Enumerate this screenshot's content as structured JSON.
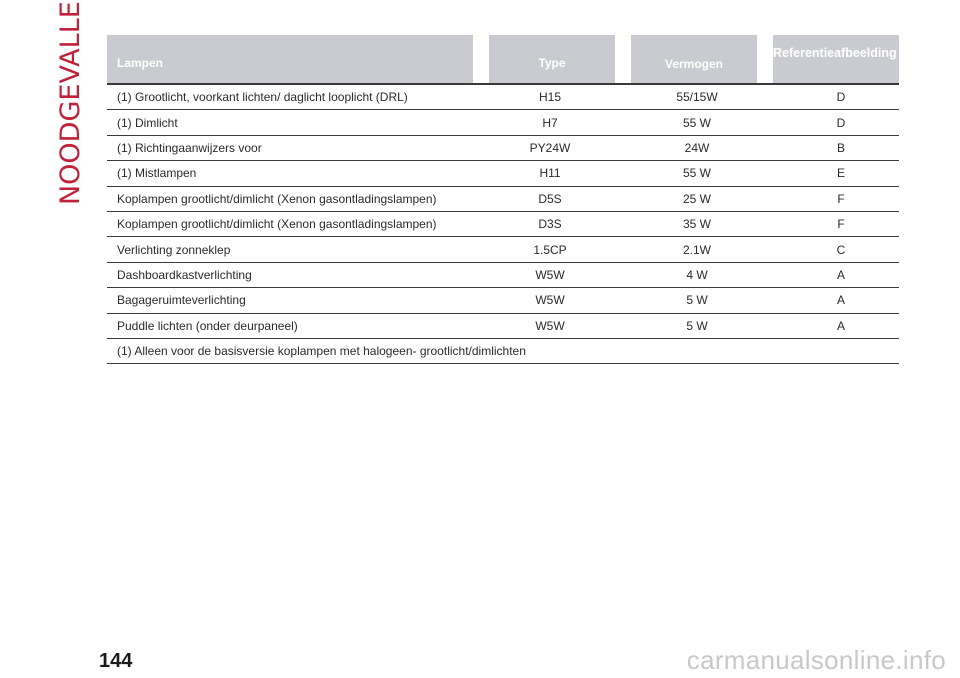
{
  "section_title": "NOODGEVALLEN",
  "table": {
    "headers": {
      "lampen": "Lampen",
      "type": "Type",
      "vermogen": "Vermogen",
      "referentie": "Referentieafbeelding"
    },
    "rows": [
      {
        "name": "(1) Grootlicht, voorkant lichten/ daglicht looplicht (DRL)",
        "type": "H15",
        "vermogen": "55/15W",
        "ref": "D"
      },
      {
        "name": "(1) Dimlicht",
        "type": "H7",
        "vermogen": "55 W",
        "ref": "D"
      },
      {
        "name": "(1) Richtingaanwijzers voor",
        "type": "PY24W",
        "vermogen": "24W",
        "ref": "B"
      },
      {
        "name": "(1) Mistlampen",
        "type": "H11",
        "vermogen": "55 W",
        "ref": "E"
      },
      {
        "name": "Koplampen grootlicht/dimlicht (Xenon gasontladingslampen)",
        "type": "D5S",
        "vermogen": "25 W",
        "ref": "F"
      },
      {
        "name": "Koplampen grootlicht/dimlicht (Xenon gasontladingslampen)",
        "type": "D3S",
        "vermogen": "35 W",
        "ref": "F"
      },
      {
        "name": "Verlichting zonneklep",
        "type": "1.5CP",
        "vermogen": "2.1W",
        "ref": "C"
      },
      {
        "name": "Dashboardkastverlichting",
        "type": "W5W",
        "vermogen": "4 W",
        "ref": "A"
      },
      {
        "name": "Bagageruimteverlichting",
        "type": "W5W",
        "vermogen": "5 W",
        "ref": "A"
      },
      {
        "name": "Puddle lichten (onder deurpaneel)",
        "type": "W5W",
        "vermogen": "5 W",
        "ref": "A"
      }
    ],
    "footnote": "(1) Alleen voor de basisversie koplampen met halogeen- grootlicht/dimlichten"
  },
  "page_number": "144",
  "watermark": "carmanualsonline.info",
  "colors": {
    "accent": "#c0223b",
    "header_bg": "#c9cbd0",
    "rule": "#3a3a3a"
  }
}
